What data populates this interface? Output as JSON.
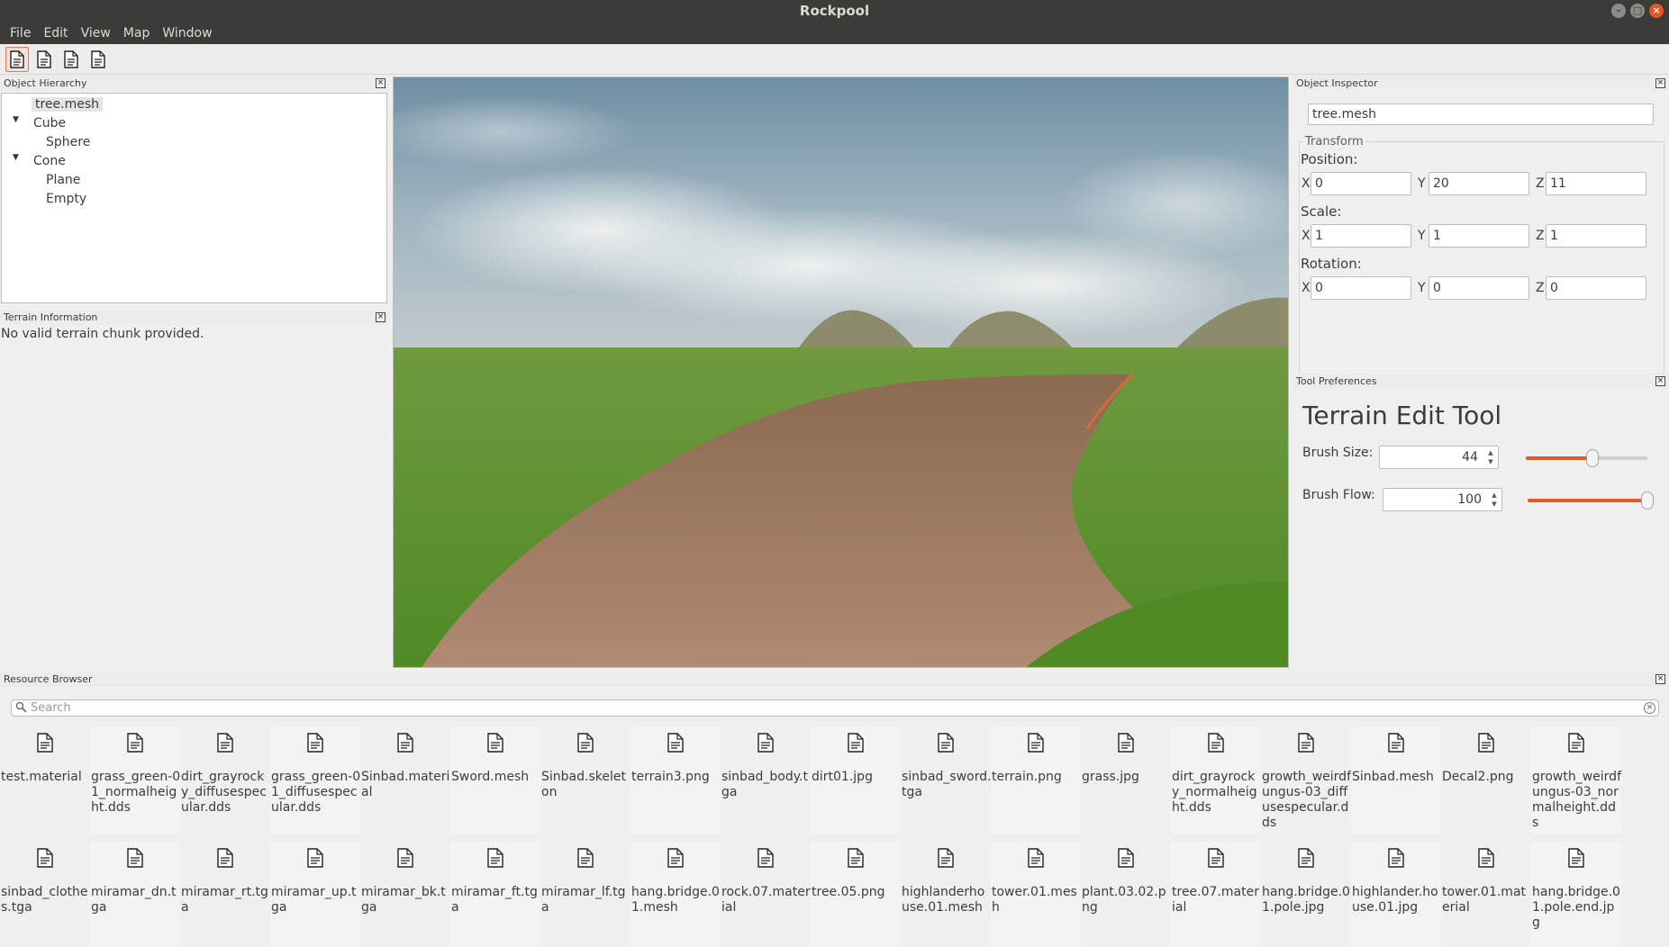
{
  "window": {
    "title": "Rockpool"
  },
  "menu": [
    "File",
    "Edit",
    "View",
    "Map",
    "Window"
  ],
  "toolbar": {
    "buttons": [
      "new-document-icon",
      "document-icon",
      "document-icon",
      "document-icon"
    ]
  },
  "hierarchy": {
    "title": "Object Hierarchy",
    "nodes": [
      {
        "label": "tree.mesh"
      },
      {
        "label": "Cube"
      },
      {
        "label": "Sphere"
      },
      {
        "label": "Cone"
      },
      {
        "label": "Plane"
      },
      {
        "label": "Empty"
      }
    ]
  },
  "terrain_info": {
    "title": "Terrain Information",
    "message": "No valid terrain chunk provided."
  },
  "inspector": {
    "title": "Object Inspector",
    "name": "tree.mesh",
    "transform_label": "Transform",
    "position": {
      "label": "Position:",
      "x": "0",
      "y": "20",
      "z": "11"
    },
    "scale": {
      "label": "Scale:",
      "x": "1",
      "y": "1",
      "z": "1"
    },
    "rotation": {
      "label": "Rotation:",
      "x": "0",
      "y": "0",
      "z": "0"
    },
    "axis": {
      "x": "X",
      "y": "Y",
      "z": "Z"
    }
  },
  "tool_prefs": {
    "title": "Tool Preferences",
    "tool_name": "Terrain Edit Tool",
    "brush_size": {
      "label": "Brush Size:",
      "value": "44",
      "slider_fraction": 0.55
    },
    "brush_flow": {
      "label": "Brush Flow:",
      "value": "100",
      "slider_fraction": 1.0
    }
  },
  "resources": {
    "title": "Resource Browser",
    "search_placeholder": "Search",
    "items": [
      "test.material",
      "grass_green-01_normalheight.dds",
      "dirt_grayrocky_diffusespecular.dds",
      "grass_green-01_diffusespecular.dds",
      "Sinbad.material",
      "Sword.mesh",
      "Sinbad.skeleton",
      "terrain3.png",
      "sinbad_body.tga",
      "dirt01.jpg",
      "sinbad_sword.tga",
      "terrain.png",
      "grass.jpg",
      "dirt_grayrocky_normalheight.dds",
      "growth_weirdfungus-03_diffusespecular.dds",
      "Sinbad.mesh",
      "Decal2.png",
      "growth_weirdfungus-03_normalheight.dds",
      "sinbad_clothes.tga",
      "miramar_dn.tga",
      "miramar_rt.tga",
      "miramar_up.tga",
      "miramar_bk.tga",
      "miramar_ft.tga",
      "miramar_lf.tga",
      "hang.bridge.01.mesh",
      "rock.07.material",
      "tree.05.png",
      "highlanderhouse.01.mesh",
      "tower.01.mesh",
      "plant.03.02.png",
      "tree.07.material",
      "hang.bridge.01.pole.jpg",
      "highlander.house.01.jpg",
      "tower.01.material",
      "hang.bridge.01.pole.end.jpg"
    ]
  },
  "colors": {
    "accent": "#e05a2b",
    "titlebar": "#3c3b37"
  }
}
